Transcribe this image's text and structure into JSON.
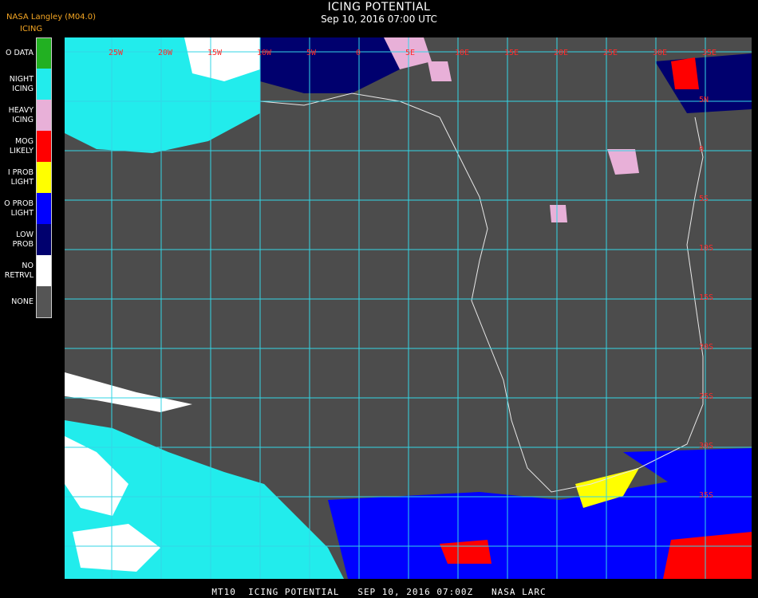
{
  "header": {
    "credit": "NASA Langley (M04.0)",
    "product": "ICING",
    "title": "ICING POTENTIAL",
    "datetime": "Sep 10, 2016 07:00 UTC"
  },
  "legend": [
    {
      "label": "O DATA",
      "color": "#22b022"
    },
    {
      "label": "NIGHT\nICING",
      "color": "#22ecec"
    },
    {
      "label": "HEAVY\nICING",
      "color": "#e8b0d8"
    },
    {
      "label": "MOG\nLIKELY",
      "color": "#ff0000"
    },
    {
      "label": "I PROB\nLIGHT",
      "color": "#ffff00"
    },
    {
      "label": "O PROB\nLIGHT",
      "color": "#0000ff"
    },
    {
      "label": "LOW\nPROB",
      "color": "#00006e"
    },
    {
      "label": "NO\nRETRVL",
      "color": "#ffffff"
    },
    {
      "label": "NONE",
      "color": "#555555"
    }
  ],
  "map": {
    "background": "#4c4c4c",
    "grid_color": "#33d6e6",
    "longitude_labels": [
      "25W",
      "20W",
      "15W",
      "10W",
      "5W",
      "0",
      "5E",
      "10E",
      "15E",
      "20E",
      "25E",
      "30E",
      "35E"
    ],
    "latitude_labels": [
      "5N",
      "0",
      "5S",
      "10S",
      "15S",
      "20S",
      "25S",
      "30S",
      "35S"
    ]
  },
  "footer": {
    "text": "MT10  ICING POTENTIAL   SEP 10, 2016 07:00Z   NASA LARC"
  }
}
